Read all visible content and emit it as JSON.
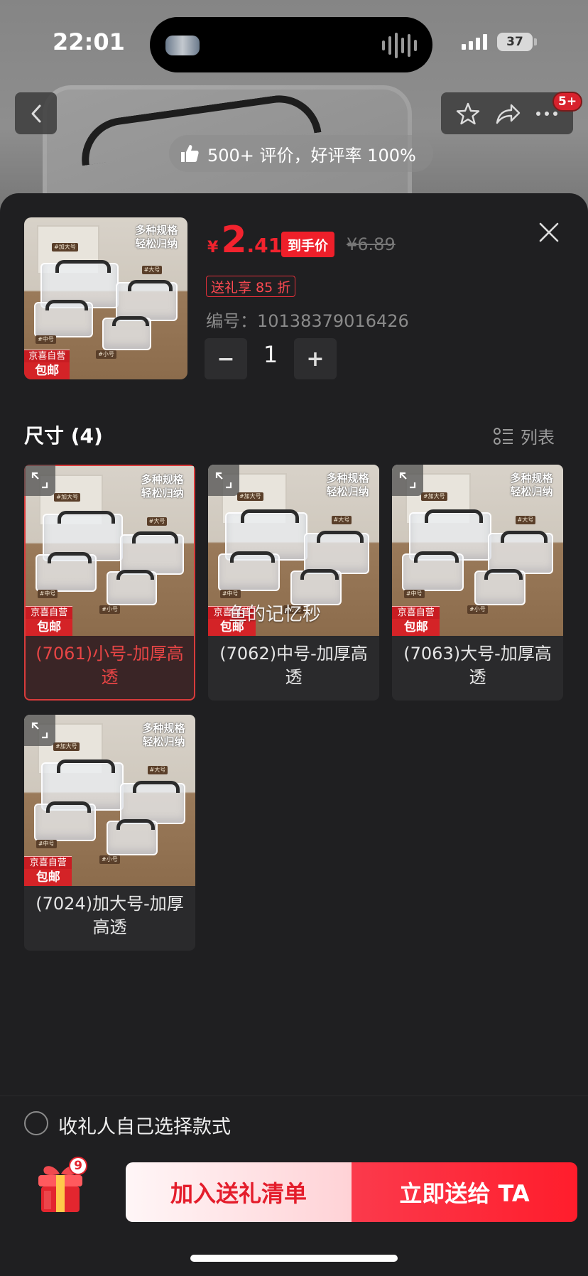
{
  "status_bar": {
    "time": "22:01",
    "battery": "37"
  },
  "product_page": {
    "rating_text": "500+ 评价，好评率 100%",
    "cart_badge": "5+"
  },
  "sheet": {
    "price": {
      "currency": "¥",
      "integer": "2",
      "decimal": ".41",
      "final_tag": "到手价",
      "original": "¥6.89"
    },
    "discount_tag": "送礼享 85 折",
    "sku": "编号：10138379016426",
    "quantity": "1",
    "qty_minus": "−",
    "qty_plus": "+",
    "section_title": "尺寸 (4)",
    "list_toggle_label": "列表",
    "image": {
      "tagline_line1": "多种规格",
      "tagline_line2": "轻松归纳",
      "chip1": "#加大号",
      "chip2": "#大号",
      "chip3": "#中号",
      "chip4": "#小号",
      "store_line1": "京喜自营",
      "store_line2": "包邮"
    },
    "options": [
      {
        "label": "(7061)小号-加厚高透",
        "selected": true
      },
      {
        "label": "(7062)中号-加厚高透",
        "selected": false
      },
      {
        "label": "(7063)大号-加厚高透",
        "selected": false
      },
      {
        "label": "(7024)加大号-加厚高透",
        "selected": false
      }
    ],
    "watermark": "鱼的记忆秒",
    "recipient_choice_label": "收礼人自己选择款式",
    "gift_badge": "9",
    "add_button": "加入送礼清单",
    "send_button": "立即送给 TA"
  },
  "colors": {
    "accent": "#f2232e",
    "sheet_bg": "#1f1f21",
    "card_bg": "#2a2a2c"
  }
}
